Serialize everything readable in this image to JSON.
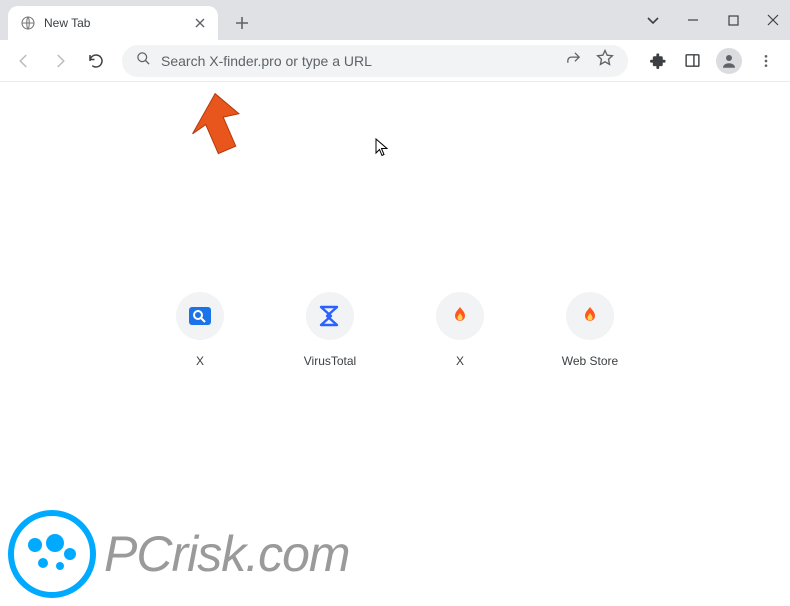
{
  "tab": {
    "title": "New Tab"
  },
  "omnibox": {
    "placeholder": "Search X-finder.pro or type a URL"
  },
  "shortcuts": [
    {
      "label": "X",
      "icon": "search-badge"
    },
    {
      "label": "VirusTotal",
      "icon": "sigma"
    },
    {
      "label": "X",
      "icon": "flame"
    },
    {
      "label": "Web Store",
      "icon": "flame"
    }
  ],
  "watermark": {
    "text": "PCrisk.com"
  }
}
